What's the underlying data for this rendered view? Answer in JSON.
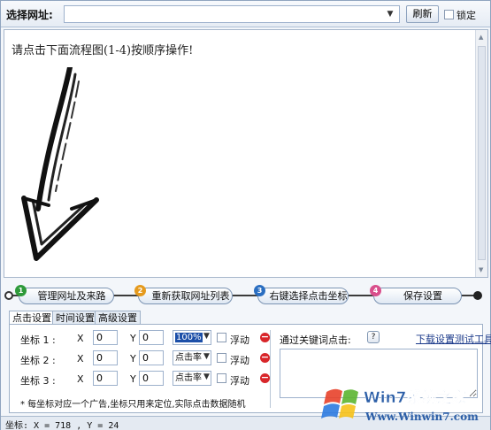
{
  "url_bar": {
    "label": "选择网址:",
    "value": "",
    "dropdown_glyph": "▼",
    "refresh_label": "刷新",
    "lock_label": "锁定",
    "lock_checked": false
  },
  "browser": {
    "instruction": "请点击下面流程图(1-4)按顺序操作!"
  },
  "steps": [
    {
      "number": "1",
      "label": "管理网址及来路",
      "badge_color": "#2e9a3a"
    },
    {
      "number": "2",
      "label": "重新获取网址列表",
      "badge_color": "#e59a1d"
    },
    {
      "number": "3",
      "label": "右键选择点击坐标",
      "badge_color": "#2a6ec1"
    },
    {
      "number": "4",
      "label": "保存设置",
      "badge_color": "#d94f8c"
    }
  ],
  "tabs": [
    {
      "label": "点击设置",
      "active": true
    },
    {
      "label": "时间设置",
      "active": false
    },
    {
      "label": "高级设置",
      "active": false
    }
  ],
  "coord_rows": [
    {
      "label": "坐标 1 :",
      "x_axis": "X",
      "x": "0",
      "y_axis": "Y",
      "y": "0",
      "rate": "100%",
      "float_label": "浮动",
      "float_checked": false,
      "delete_glyph": "−"
    },
    {
      "label": "坐标 2 :",
      "x_axis": "X",
      "x": "0",
      "y_axis": "Y",
      "y": "0",
      "rate": "点击率",
      "float_label": "浮动",
      "float_checked": false,
      "delete_glyph": "−"
    },
    {
      "label": "坐标 3 :",
      "x_axis": "X",
      "x": "0",
      "y_axis": "Y",
      "y": "0",
      "rate": "点击率",
      "float_label": "浮动",
      "float_checked": false,
      "delete_glyph": "−"
    }
  ],
  "note": "* 每坐标对应一个广告,坐标只用来定位,实际点击数据随机",
  "keywords": {
    "label": "通过关键词点击:",
    "help_glyph": "?",
    "download_link": "下载设置测试工具",
    "value": ""
  },
  "status": {
    "text": "坐标: X = 718 , Y = 24"
  },
  "watermark": {
    "brand": "Win7系统之家",
    "url": "Www.Winwin7.com"
  },
  "colors": {
    "accent": "#2a6ec1",
    "delete_red": "#d8262a",
    "link_blue": "#1b3a8a"
  },
  "icons": {
    "delete": "minus-circle-icon",
    "help": "question-icon",
    "dropdown": "chevron-down-icon",
    "illustration": "hand-drawn-arrow-icon"
  }
}
